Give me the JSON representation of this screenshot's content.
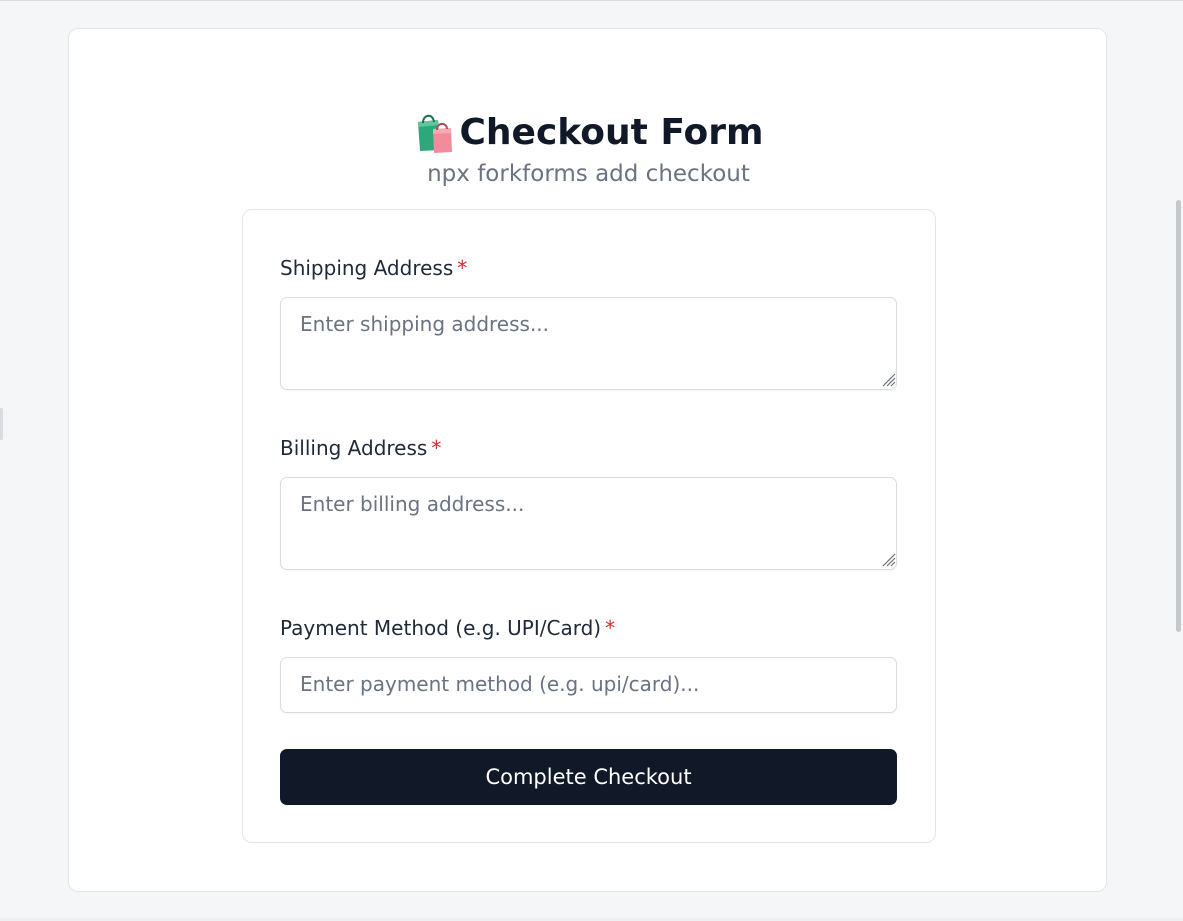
{
  "header": {
    "title": "Checkout Form",
    "subtitle": "npx forkforms add checkout",
    "title_icon": "shopping-bags-icon"
  },
  "form": {
    "fields": [
      {
        "label": "Shipping Address",
        "required_mark": "*",
        "placeholder": "Enter shipping address...",
        "value": "",
        "type": "textarea"
      },
      {
        "label": "Billing Address",
        "required_mark": "*",
        "placeholder": "Enter billing address...",
        "value": "",
        "type": "textarea"
      },
      {
        "label": "Payment Method (e.g. UPI/Card)",
        "required_mark": "*",
        "placeholder": "Enter payment method (e.g. upi/card)...",
        "value": "",
        "type": "text"
      }
    ],
    "submit_label": "Complete Checkout"
  },
  "colors": {
    "button_bg": "#111827",
    "required": "#dc2626",
    "subtitle": "#6b7280"
  }
}
